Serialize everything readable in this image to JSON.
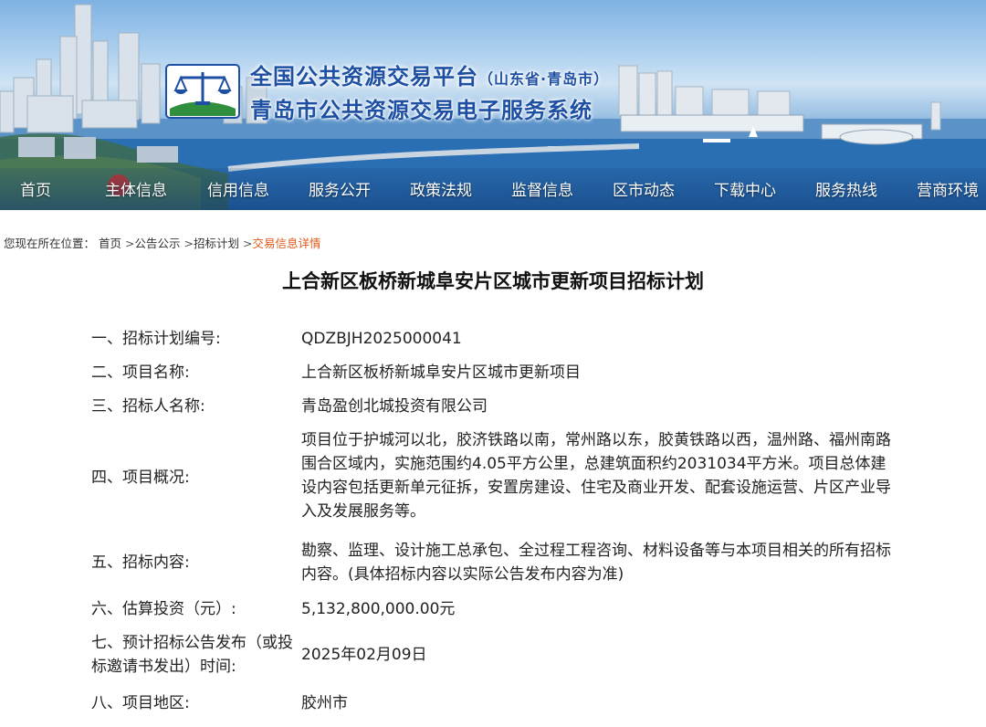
{
  "header": {
    "title_main": "全国公共资源交易平台",
    "title_sub": "（山东省·青岛市）",
    "title_system": "青岛市公共资源交易电子服务系统"
  },
  "nav": {
    "items": [
      {
        "label": "首页"
      },
      {
        "label": "主体信息"
      },
      {
        "label": "信用信息"
      },
      {
        "label": "服务公开"
      },
      {
        "label": "政策法规"
      },
      {
        "label": "监督信息"
      },
      {
        "label": "区市动态"
      },
      {
        "label": "下载中心"
      },
      {
        "label": "服务热线"
      },
      {
        "label": "营商环境"
      }
    ]
  },
  "breadcrumb": {
    "prefix": "您现在所在位置：",
    "items": [
      {
        "label": "首页"
      },
      {
        "label": "公告公示"
      },
      {
        "label": "招标计划"
      },
      {
        "label": "交易信息详情"
      }
    ],
    "separator": ">"
  },
  "page": {
    "title": "上合新区板桥新城阜安片区城市更新项目招标计划"
  },
  "details": [
    {
      "label": "一、招标计划编号:",
      "value": "QDZBJH2025000041"
    },
    {
      "label": "二、项目名称:",
      "value": "上合新区板桥新城阜安片区城市更新项目"
    },
    {
      "label": "三、招标人名称:",
      "value": "青岛盈创北城投资有限公司"
    },
    {
      "label": "四、项目概况:",
      "value": "项目位于护城河以北，胶济铁路以南，常州路以东，胶黄铁路以西，温州路、福州南路围合区域内，实施范围约4.05平方公里，总建筑面积约2031034平方米。项目总体建设内容包括更新单元征拆，安置房建设、住宅及商业开发、配套设施运营、片区产业导入及发展服务等。"
    },
    {
      "label": "五、招标内容:",
      "value": "勘察、监理、设计施工总承包、全过程工程咨询、材料设备等与本项目相关的所有招标内容。(具体招标内容以实际公告发布内容为准)"
    },
    {
      "label": "六、估算投资（元）:",
      "value": "5,132,800,000.00元"
    },
    {
      "label": "七、预计招标公告发布（或投标邀请书发出）时间:",
      "value": "2025年02月09日"
    },
    {
      "label": "八、项目地区:",
      "value": "胶州市"
    }
  ],
  "colors": {
    "title_blue": "#1d4fa3",
    "breadcrumb_current": "#e05a1a",
    "nav_text": "#ffffff"
  }
}
